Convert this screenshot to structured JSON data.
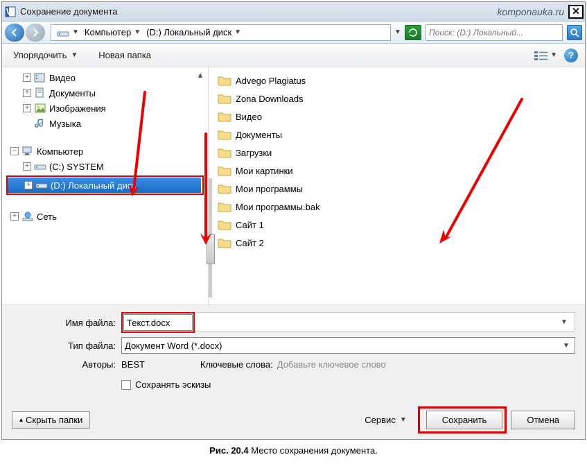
{
  "title": "Сохранение документа",
  "watermark": "komponauka.ru",
  "breadcrumb": {
    "computer": "Компьютер",
    "drive": "(D:) Локальный диск"
  },
  "search_placeholder": "Поиск: (D:) Локальный...",
  "toolbar": {
    "organize": "Упорядочить",
    "new_folder": "Новая папка"
  },
  "tree": {
    "libraries": {
      "video": "Видео",
      "documents": "Документы",
      "pictures": "Изображения",
      "music": "Музыка"
    },
    "computer": {
      "label": "Компьютер",
      "c": "(C:) SYSTEM",
      "d": "(D:) Локальный диск"
    },
    "network": "Сеть"
  },
  "files": [
    "Advego Plagiatus",
    "Zona Downloads",
    "Видео",
    "Документы",
    "Загрузки",
    "Мои картинки",
    "Мои программы",
    "Мои программы.bak",
    "Сайт 1",
    "Сайт 2"
  ],
  "form": {
    "filename_label": "Имя файла:",
    "filename_value": "Текст.docx",
    "filetype_label": "Тип файла:",
    "filetype_value": "Документ Word (*.docx)",
    "authors_label": "Авторы:",
    "authors_value": "BEST",
    "keywords_label": "Ключевые слова:",
    "keywords_value": "Добавьте ключевое слово",
    "thumbnails": "Сохранять эскизы"
  },
  "footer": {
    "hide_folders": "Скрыть папки",
    "service": "Сервис",
    "save": "Сохранить",
    "cancel": "Отмена"
  },
  "caption_prefix": "Рис. 20.4",
  "caption_text": " Место сохранения документа."
}
